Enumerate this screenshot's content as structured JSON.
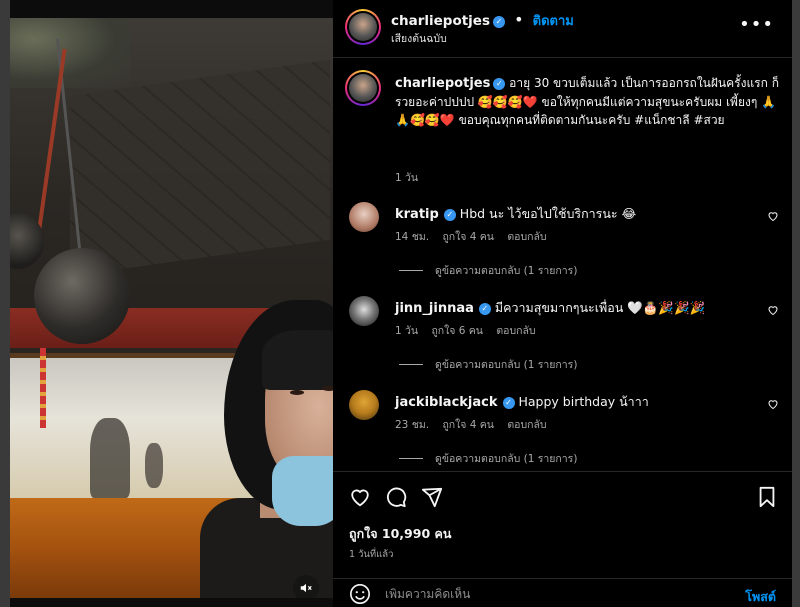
{
  "header": {
    "username": "charliepotjes",
    "follow_label": "ติดตาม",
    "audio_label": "เสียงต้นฉบับ",
    "more_icon": "more-options-icon"
  },
  "caption": {
    "username": "charliepotjes",
    "text": "อายุ 30 ขวบเต็มแล้ว เป็นการออกรถในฝันครั้งแรก ก็รวยอะค่าปปปป 🥰🥰🥰❤️ ขอให้ทุกคนมีแต่ความสุขนะครับผม เพี้ยงๆ 🙏🙏🥰🥰❤️ ขอบคุณทุกคนที่ติดตามกันนะครับ #แน็กชาลี #สวย",
    "time": "1 วัน"
  },
  "comments": [
    {
      "username": "kratip",
      "text": "Hbd นะ ไว้ขอไปใช้บริการนะ 😂",
      "time": "14 ชม.",
      "likes": "ถูกใจ 4 คน",
      "reply_label": "ตอบกลับ",
      "view_replies": "ดูข้อความตอบกลับ (1 รายการ)"
    },
    {
      "username": "jinn_jinnaa",
      "text": "มีความสุขมากๆนะเพื่อน 🤍🎂🎉🎉🎉",
      "time": "1 วัน",
      "likes": "ถูกใจ 6 คน",
      "reply_label": "ตอบกลับ",
      "view_replies": "ดูข้อความตอบกลับ (1 รายการ)"
    },
    {
      "username": "jackiblackjack",
      "text": "Happy birthday น้าาา",
      "time": "23 ชม.",
      "likes": "ถูกใจ 4 คน",
      "reply_label": "ตอบกลับ",
      "view_replies": "ดูข้อความตอบกลับ (1 รายการ)"
    }
  ],
  "actions": {
    "like_icon": "heart-icon",
    "comment_icon": "comment-icon",
    "share_icon": "share-icon",
    "save_icon": "bookmark-icon",
    "likes_count": "ถูกใจ 10,990 คน",
    "posted_time": "1 วันที่แล้ว"
  },
  "composer": {
    "emoji_icon": "emoji-icon",
    "placeholder": "เพิ่มความคิดเห็น",
    "post_label": "โพสต์"
  },
  "media": {
    "mute_icon": "speaker-muted-icon"
  },
  "colors": {
    "accent": "#0095f6",
    "verified": "#3897f0",
    "background": "#000000"
  }
}
